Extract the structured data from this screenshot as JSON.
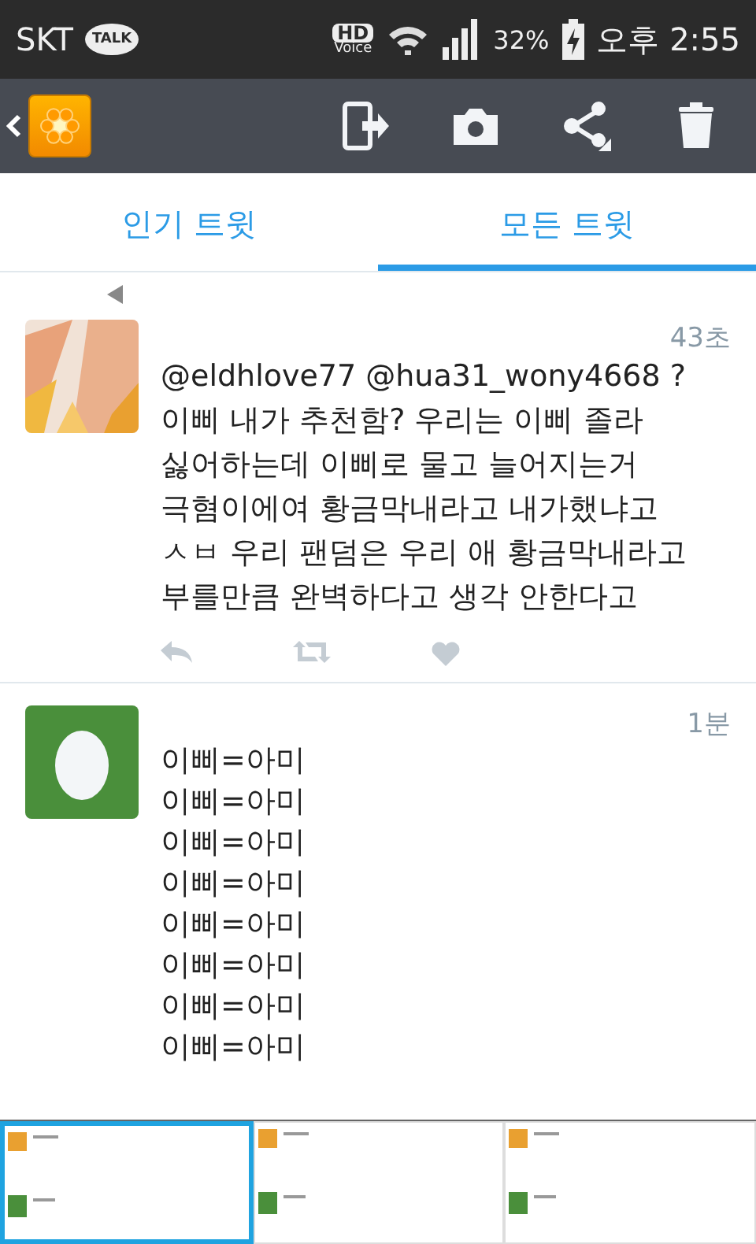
{
  "status_bar": {
    "carrier": "SKT",
    "talk_badge": "TALK",
    "hd": "HD",
    "voice": "Voice",
    "battery": "32%",
    "time": "오후 2:55"
  },
  "tabs": [
    {
      "label": "인기 트윗",
      "selected": false
    },
    {
      "label": "모든 트윗",
      "selected": true
    }
  ],
  "tweets": [
    {
      "reply_context": true,
      "time": "43초",
      "lines": [
        "@eldhlove77 @hua31_wony4668 ?",
        "이삐 내가 추천함? 우리는 이삐 졸라",
        "싫어하는데 이삐로 물고 늘어지는거",
        "극혐이에여 황금막내라고 내가했냐고",
        "ㅅㅂ 우리 팬덤은 우리 애 황금막내라고",
        "부를만큼 완벽하다고 생각 안한다고"
      ],
      "show_actions": true
    },
    {
      "avatar": {
        "kind": "egg"
      },
      "reply_context": false,
      "time": "1분",
      "lines": [
        "이삐=아미",
        "이삐=아미",
        "이삐=아미",
        "이삐=아미",
        "이삐=아미",
        "이삐=아미",
        "이삐=아미",
        "이삐=아미"
      ],
      "show_actions": false
    }
  ],
  "thumbnail_strip": [
    {
      "selected": true
    },
    {
      "selected": false
    },
    {
      "selected": false
    }
  ]
}
